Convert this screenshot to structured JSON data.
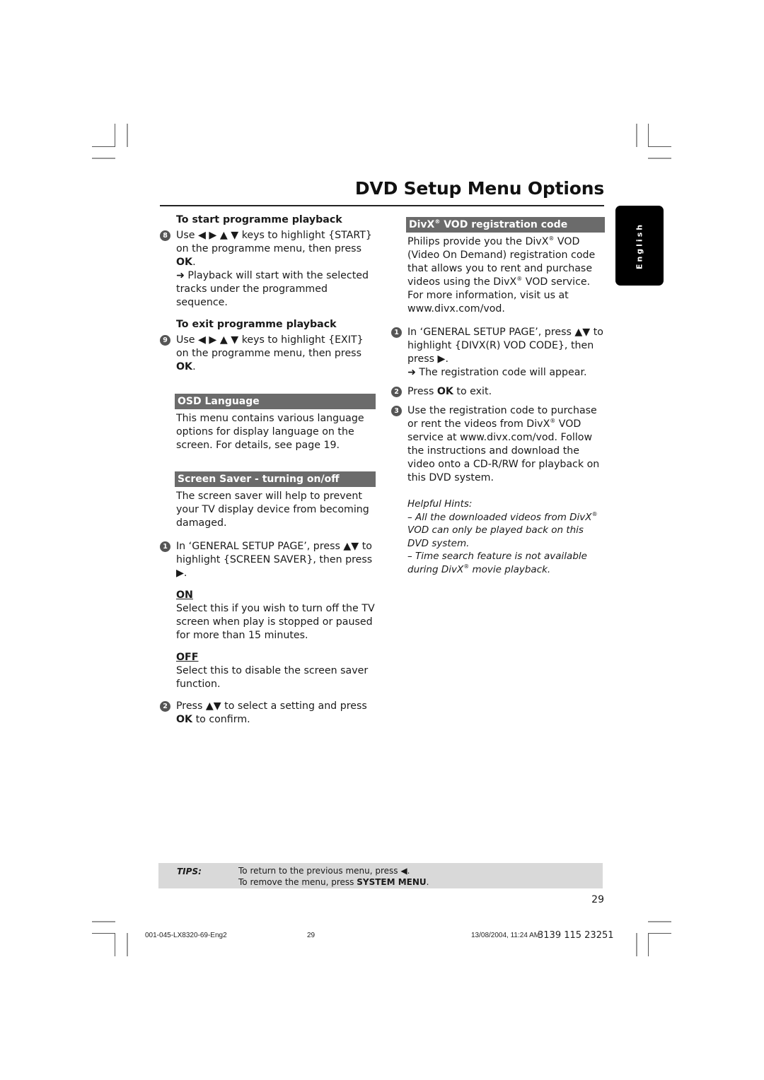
{
  "header": {
    "title": "DVD Setup Menu Options"
  },
  "side_tab": {
    "label": "English"
  },
  "left_column": {
    "start_playback": {
      "heading": "To start programme playback",
      "step_number": "8",
      "text_pre": "Use ◀ ▶ ▲ ▼ keys to highlight {START} on the programme menu, then press ",
      "bold": "OK",
      "text_post": ".",
      "result": "➜ Playback will start with the selected tracks under the programmed sequence."
    },
    "exit_playback": {
      "heading": "To exit programme playback",
      "step_number": "9",
      "text_pre": "Use ◀ ▶ ▲ ▼ keys to highlight {EXIT} on the programme menu, then press ",
      "bold": "OK",
      "text_post": "."
    },
    "osd_language": {
      "heading": "OSD Language",
      "body": "This menu contains various language options for display language on the screen.  For details, see page 19."
    },
    "screen_saver": {
      "heading": "Screen Saver - turning on/off",
      "body": "The screen saver will help to prevent your TV display device from becoming damaged.",
      "step1_number": "1",
      "step1_text": "In ‘GENERAL SETUP PAGE’, press ▲▼ to highlight {SCREEN SAVER}, then press ▶.",
      "on_label": "ON",
      "on_text": "Select this if you wish to turn off the TV screen when play is stopped or paused for more than 15 minutes.",
      "off_label": "OFF",
      "off_text": "Select this to disable the screen saver function.",
      "step2_number": "2",
      "step2_pre": "Press ▲▼  to select a setting and press ",
      "step2_bold": "OK",
      "step2_post": " to confirm."
    }
  },
  "right_column": {
    "divx": {
      "heading_pre": "DivX",
      "heading_sup": "®",
      "heading_post": " VOD registration code",
      "intro_1": "Philips provide you the DivX",
      "intro_sup1": "®",
      "intro_2": " VOD (Video On Demand) registration code that allows you to rent and purchase videos using the DivX",
      "intro_sup2": "®",
      "intro_3": " VOD service. For more information, visit us at www.divx.com/vod.",
      "step1_number": "1",
      "step1_text": "In ‘GENERAL SETUP PAGE’, press ▲▼ to highlight {DIVX(R) VOD CODE}, then press ▶.",
      "step1_result": "➜ The registration code will appear.",
      "step2_number": "2",
      "step2_pre": "Press ",
      "step2_bold": "OK",
      "step2_post": " to exit.",
      "step3_number": "3",
      "step3_pre": "Use the registration code to purchase or rent the videos from DivX",
      "step3_sup": "®",
      "step3_post": " VOD service at www.divx.com/vod.  Follow the instructions and download the video onto a CD-R/RW for playback on this DVD system."
    },
    "hints": {
      "title": "Helpful Hints:",
      "hint1_pre": "–  All the downloaded videos from DivX",
      "hint1_sup": "®",
      "hint1_post": " VOD can only be played back on this DVD system.",
      "hint2_pre": "–  Time search feature is not available during DivX",
      "hint2_sup": "®",
      "hint2_post": " movie playback."
    }
  },
  "tips": {
    "label": "TIPS:",
    "line1": "To return to the previous menu, press ◀.",
    "line2_pre": "To remove the menu, press ",
    "line2_bold": "SYSTEM MENU",
    "line2_post": "."
  },
  "page_number": "29",
  "footer": {
    "file": "001-045-LX8320-69-Eng2",
    "page": "29",
    "timestamp": "13/08/2004, 11:24 AM",
    "code": "3139 115 23251"
  }
}
